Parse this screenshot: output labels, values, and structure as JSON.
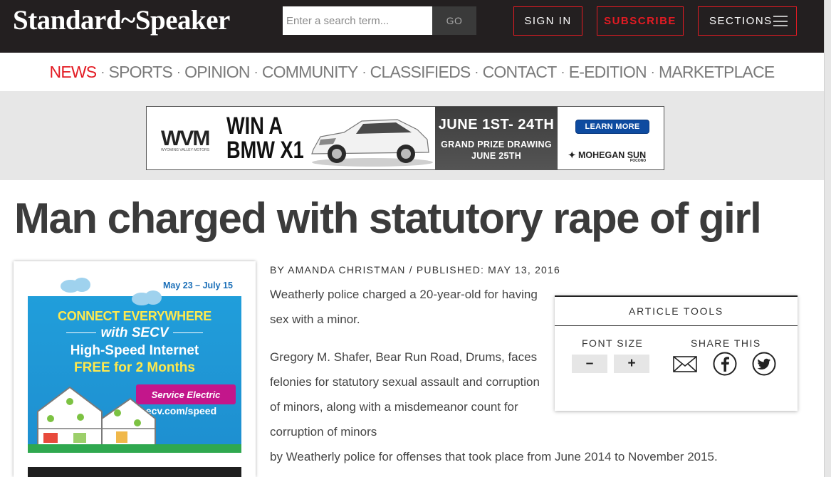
{
  "header": {
    "logo": "Standard~Speaker",
    "search_placeholder": "Enter a search term...",
    "go_label": "GO",
    "signin_label": "SIGN IN",
    "subscribe_label": "SUBSCRIBE",
    "sections_label": "SECTIONS"
  },
  "nav": {
    "items": [
      "NEWS",
      "SPORTS",
      "OPINION",
      "COMMUNITY",
      "CLASSIFIEDS",
      "CONTACT",
      "E-EDITION",
      "MARKETPLACE"
    ],
    "active": "NEWS",
    "separator": "·"
  },
  "banner_ad": {
    "brand": "WVM",
    "brand_sub": "WYOMING VALLEY MOTORS",
    "headline_line1": "WIN A",
    "headline_line2": "BMW X1",
    "dates": "JUNE 1ST- 24TH",
    "drawing_line1": "GRAND PRIZE DRAWING",
    "drawing_line2": "JUNE 25TH",
    "cta": "LEARN MORE",
    "sponsor": "MOHEGAN SUN",
    "sponsor_sub": "POCONO"
  },
  "article": {
    "headline": "Man charged with statutory rape of girl",
    "byline": "BY AMANDA CHRISTMAN / PUBLISHED: MAY 13, 2016",
    "p1": "Weatherly police charged a 20-year-old for having sex with a minor.",
    "p2": "Gregory M. Shafer, Bear Run Road, Drums, faces felonies for statutory sexual assault and corruption of minors, along with a misdemeanor count for corruption of minors",
    "p2_last": "by Weatherly police for offenses that took place from June 2014 to November 2015."
  },
  "tools": {
    "title": "ARTICLE TOOLS",
    "font_size_label": "FONT SIZE",
    "share_label": "SHARE THIS",
    "minus": "–",
    "plus": "+"
  },
  "side_ad": {
    "dates": "May 23 – July 15",
    "line1": "CONNECT EVERYWHERE",
    "line2": "with SECV",
    "line3": "High-Speed Internet",
    "line4": "FREE for 2 Months",
    "logo_text": "Service Electric",
    "url": "secv.com/speed"
  },
  "colors": {
    "accent_red": "#e31b23",
    "header_bg": "#231f20",
    "ad_blue": "#21a0dc",
    "ad_yellow": "#ffe94d"
  }
}
